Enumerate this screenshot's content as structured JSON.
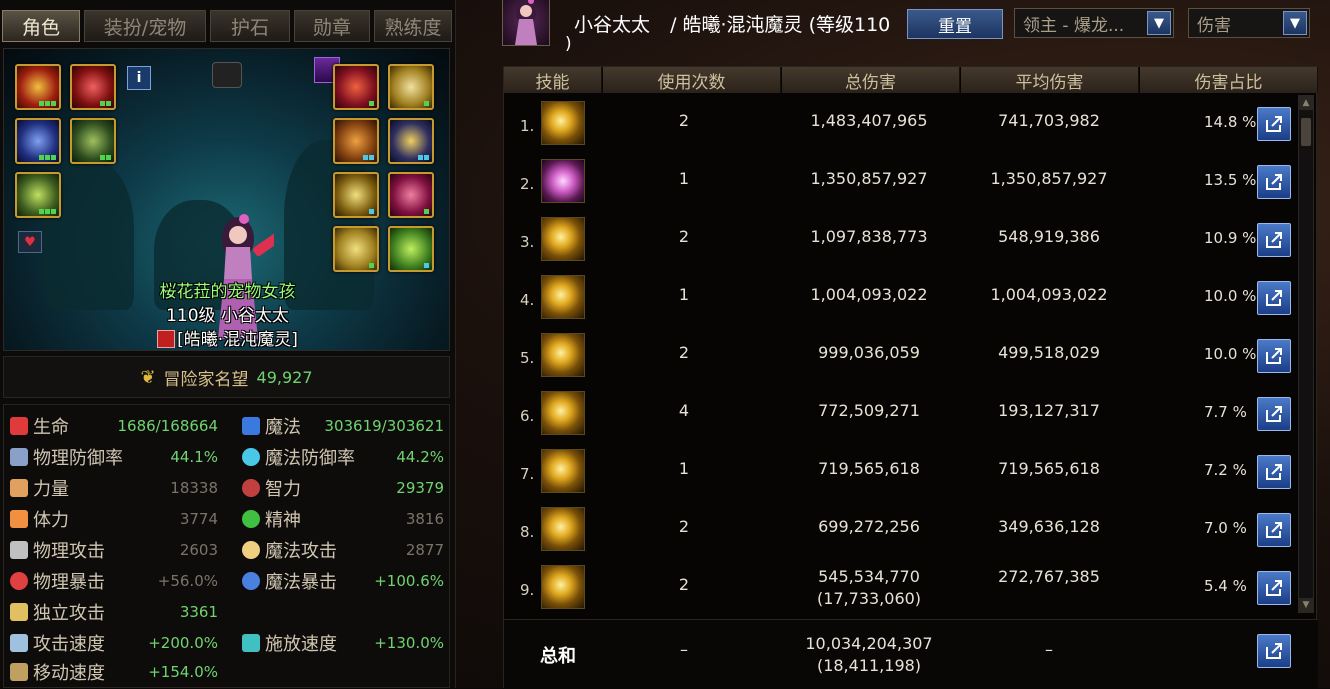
{
  "left": {
    "tabs": [
      "角色",
      "装扮/宠物",
      "护石",
      "勋章",
      "熟练度"
    ],
    "info_button": "i",
    "pet_name": "桜花菈的宠物女孩",
    "char_line": "110级  小谷太太",
    "char_class": "[皓曦·混沌魔灵]",
    "fame_label": "冒险家名望",
    "fame_value": "49,927",
    "stats": [
      {
        "label": "生命",
        "value": "1686/168664",
        "icon": "heart-icon",
        "color": "#e03a3a"
      },
      {
        "label": "魔法",
        "value": "303619/303621",
        "icon": "blue-heart-icon",
        "color": "#3a7ae0"
      },
      {
        "label": "物理防御率",
        "value": "44.1%",
        "icon": "shield-icon",
        "color": "#8aa0c8"
      },
      {
        "label": "魔法防御率",
        "value": "44.2%",
        "icon": "orb-icon",
        "color": "#4ac8e8"
      },
      {
        "label": "力量",
        "value": "18338",
        "icon": "arm-icon",
        "color": "#e0a060"
      },
      {
        "label": "智力",
        "value": "29379",
        "icon": "eye-icon",
        "color": "#c04040"
      },
      {
        "label": "体力",
        "value": "3774",
        "icon": "body-icon",
        "color": "#f09040"
      },
      {
        "label": "精神",
        "value": "3816",
        "icon": "spirit-icon",
        "color": "#40c040"
      },
      {
        "label": "物理攻击",
        "value": "2603",
        "icon": "sword-icon",
        "color": "#c0c0c0"
      },
      {
        "label": "魔法攻击",
        "value": "2877",
        "icon": "spark-icon",
        "color": "#f0d080"
      },
      {
        "label": "物理暴击",
        "value": "+56.0%",
        "icon": "crosshair-icon",
        "color": "#e04040"
      },
      {
        "label": "魔法暴击",
        "value": "+100.6%",
        "icon": "magic-eye-icon",
        "color": "#4a80e0"
      },
      {
        "label": "独立攻击",
        "value": "3361",
        "icon": "swords-icon",
        "color": "#e0c060"
      },
      {
        "label": "攻击速度",
        "value": "+200.0%",
        "icon": "speed-sword-icon",
        "color": "#a0c0e0"
      },
      {
        "label": "施放速度",
        "value": "+130.0%",
        "icon": "cast-icon",
        "color": "#40c0c0"
      },
      {
        "label": "移动速度",
        "value": "+154.0%",
        "icon": "boot-icon",
        "color": "#c0a060"
      }
    ]
  },
  "header": {
    "char_name": "小谷太太",
    "class_line": "/ 皓曦·混沌魔灵 (等级110",
    "close_paren": ")",
    "reset_label": "重置",
    "boss_select": "领主 - 爆龙...",
    "type_select": "伤害"
  },
  "table": {
    "headers": [
      "技能",
      "使用次数",
      "总伤害",
      "平均伤害",
      "伤害占比"
    ],
    "rows": [
      {
        "n": "1.",
        "uses": "2",
        "total": "1,483,407,965",
        "avg": "741,703,982",
        "pct": "14.8  %",
        "skill_icon": "sun-burst-skill-icon"
      },
      {
        "n": "2.",
        "uses": "1",
        "total": "1,350,857,927",
        "avg": "1,350,857,927",
        "pct": "13.5  %",
        "skill_icon": "pink-vortex-skill-icon"
      },
      {
        "n": "3.",
        "uses": "2",
        "total": "1,097,838,773",
        "avg": "548,919,386",
        "pct": "10.9  %",
        "skill_icon": "gold-slash-skill-icon"
      },
      {
        "n": "4.",
        "uses": "1",
        "total": "1,004,093,022",
        "avg": "1,004,093,022",
        "pct": "10.0  %",
        "skill_icon": "gold-sigil-skill-icon"
      },
      {
        "n": "5.",
        "uses": "2",
        "total": "999,036,059",
        "avg": "499,518,029",
        "pct": "10.0  %",
        "skill_icon": "gold-beam-skill-icon"
      },
      {
        "n": "6.",
        "uses": "4",
        "total": "772,509,271",
        "avg": "193,127,317",
        "pct": "7.7  %",
        "skill_icon": "gold-v-skill-icon"
      },
      {
        "n": "7.",
        "uses": "1",
        "total": "719,565,618",
        "avg": "719,565,618",
        "pct": "7.2  %",
        "skill_icon": "gold-ring-skill-icon"
      },
      {
        "n": "8.",
        "uses": "2",
        "total": "699,272,256",
        "avg": "349,636,128",
        "pct": "7.0  %",
        "skill_icon": "gold-pillar-skill-icon"
      },
      {
        "n": "9.",
        "uses": "2",
        "total": "545,534,770",
        "total_sub": "(17,733,060)",
        "avg": "272,767,385",
        "pct": "5.4  %",
        "skill_icon": "gold-blade-skill-icon"
      }
    ],
    "total": {
      "label": "总和",
      "uses": "–",
      "total": "10,034,204,307",
      "total_sub": "(18,411,198)",
      "avg": "–"
    }
  }
}
